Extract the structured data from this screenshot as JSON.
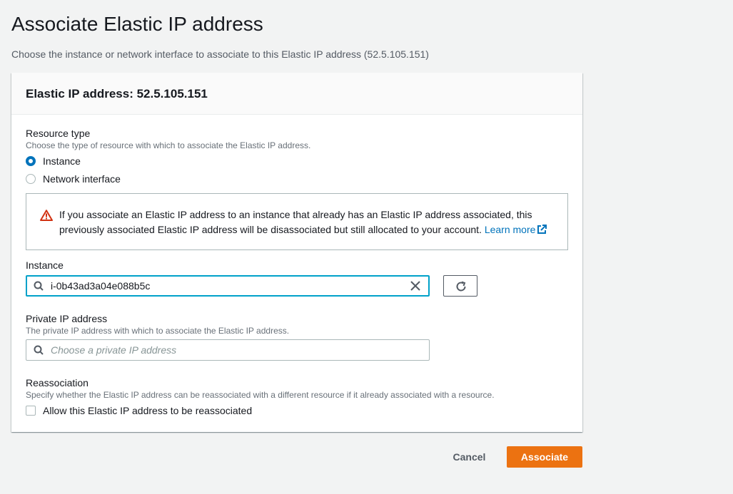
{
  "page": {
    "title": "Associate Elastic IP address",
    "subtitle": "Choose the instance or network interface to associate to this Elastic IP address (52.5.105.151)"
  },
  "panel": {
    "title": "Elastic IP address: 52.5.105.151"
  },
  "resource_type": {
    "label": "Resource type",
    "description": "Choose the type of resource with which to associate the Elastic IP address.",
    "options": [
      {
        "label": "Instance",
        "selected": true
      },
      {
        "label": "Network interface",
        "selected": false
      }
    ]
  },
  "alert": {
    "text": "If you associate an Elastic IP address to an instance that already has an Elastic IP address associated, this previously associated Elastic IP address will be disassociated but still allocated to your account.",
    "link_text": "Learn more",
    "icon": "warning-icon",
    "icon_color": "#d13212"
  },
  "instance": {
    "label": "Instance",
    "value": "i-0b43ad3a04e088b5c"
  },
  "private_ip": {
    "label": "Private IP address",
    "description": "The private IP address with which to associate the Elastic IP address.",
    "placeholder": "Choose a private IP address"
  },
  "reassociation": {
    "label": "Reassociation",
    "description": "Specify whether the Elastic IP address can be reassociated with a different resource if it already associated with a resource.",
    "checkbox_label": "Allow this Elastic IP address to be reassociated",
    "checked": false
  },
  "footer": {
    "cancel_label": "Cancel",
    "associate_label": "Associate",
    "accent": "#ec7211"
  }
}
